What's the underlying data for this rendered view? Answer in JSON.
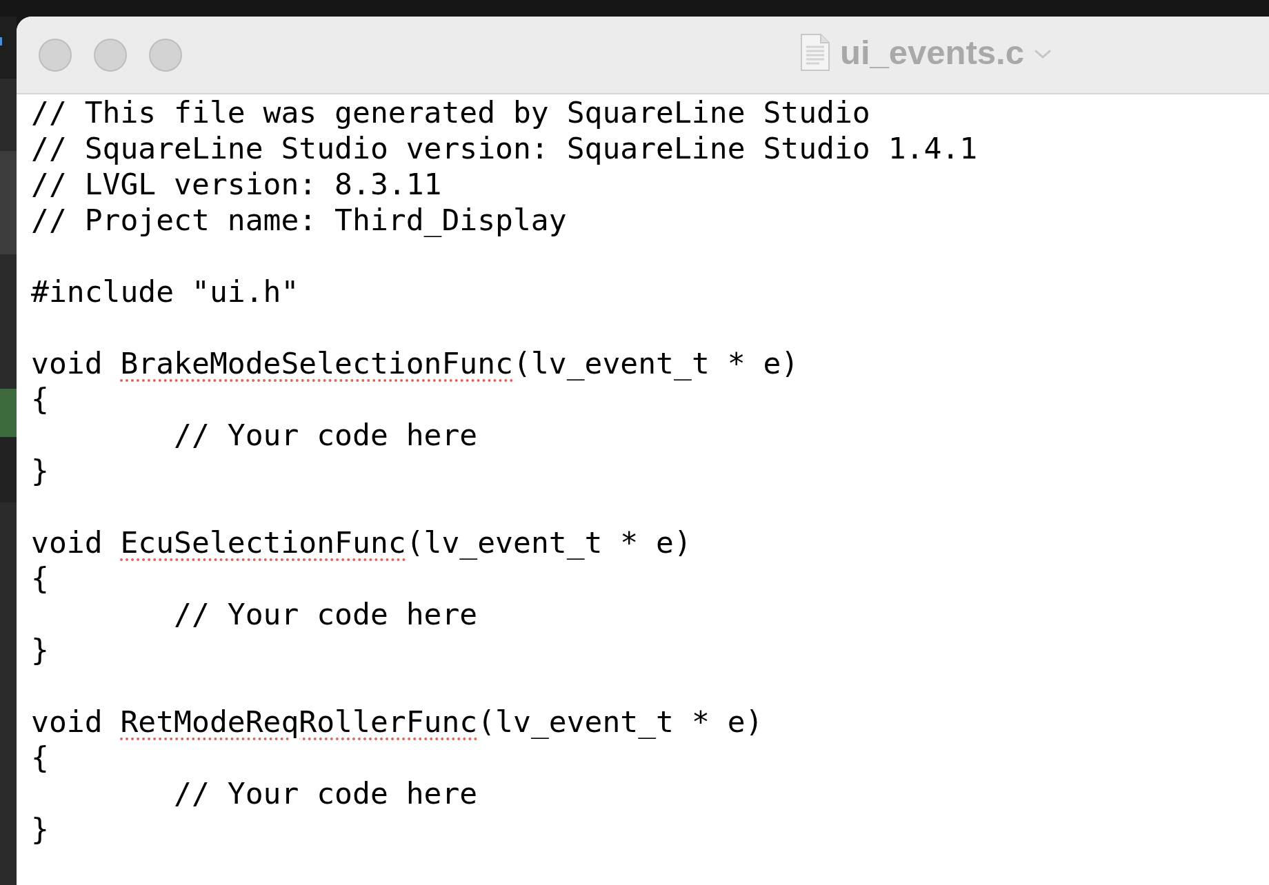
{
  "window": {
    "title": "ui_events.c"
  },
  "paragraphs": [
    {
      "lines": [
        [
          {
            "text": "// This file was generated by SquareLine Studio",
            "misspelled": false
          }
        ],
        [
          {
            "text": "// SquareLine Studio version: SquareLine Studio 1.4.1",
            "misspelled": false
          }
        ],
        [
          {
            "text": "// LVGL version: 8.3.11",
            "misspelled": false
          }
        ],
        [
          {
            "text": "// Project name: Third_Display",
            "misspelled": false
          }
        ]
      ]
    },
    {
      "lines": [
        [
          {
            "text": "#include \"ui.h\"",
            "misspelled": false
          }
        ]
      ]
    },
    {
      "lines": [
        [
          {
            "text": "void ",
            "misspelled": false
          },
          {
            "text": "BrakeModeSelectionFunc",
            "misspelled": true
          },
          {
            "text": "(lv_event_t * e)",
            "misspelled": false
          }
        ],
        [
          {
            "text": "{",
            "misspelled": false
          }
        ],
        [
          {
            "text": "\t// Your code here",
            "misspelled": false
          }
        ],
        [
          {
            "text": "}",
            "misspelled": false
          }
        ]
      ]
    },
    {
      "lines": [
        [
          {
            "text": "void ",
            "misspelled": false
          },
          {
            "text": "EcuSelectionFunc",
            "misspelled": true
          },
          {
            "text": "(lv_event_t * e)",
            "misspelled": false
          }
        ],
        [
          {
            "text": "{",
            "misspelled": false
          }
        ],
        [
          {
            "text": "\t// Your code here",
            "misspelled": false
          }
        ],
        [
          {
            "text": "}",
            "misspelled": false
          }
        ]
      ]
    },
    {
      "lines": [
        [
          {
            "text": "void ",
            "misspelled": false
          },
          {
            "text": "RetModeReqRollerFunc",
            "misspelled": true
          },
          {
            "text": "(lv_event_t * e)",
            "misspelled": false
          }
        ],
        [
          {
            "text": "{",
            "misspelled": false
          }
        ],
        [
          {
            "text": "\t// Your code here",
            "misspelled": false
          }
        ],
        [
          {
            "text": "}",
            "misspelled": false
          }
        ]
      ]
    }
  ]
}
